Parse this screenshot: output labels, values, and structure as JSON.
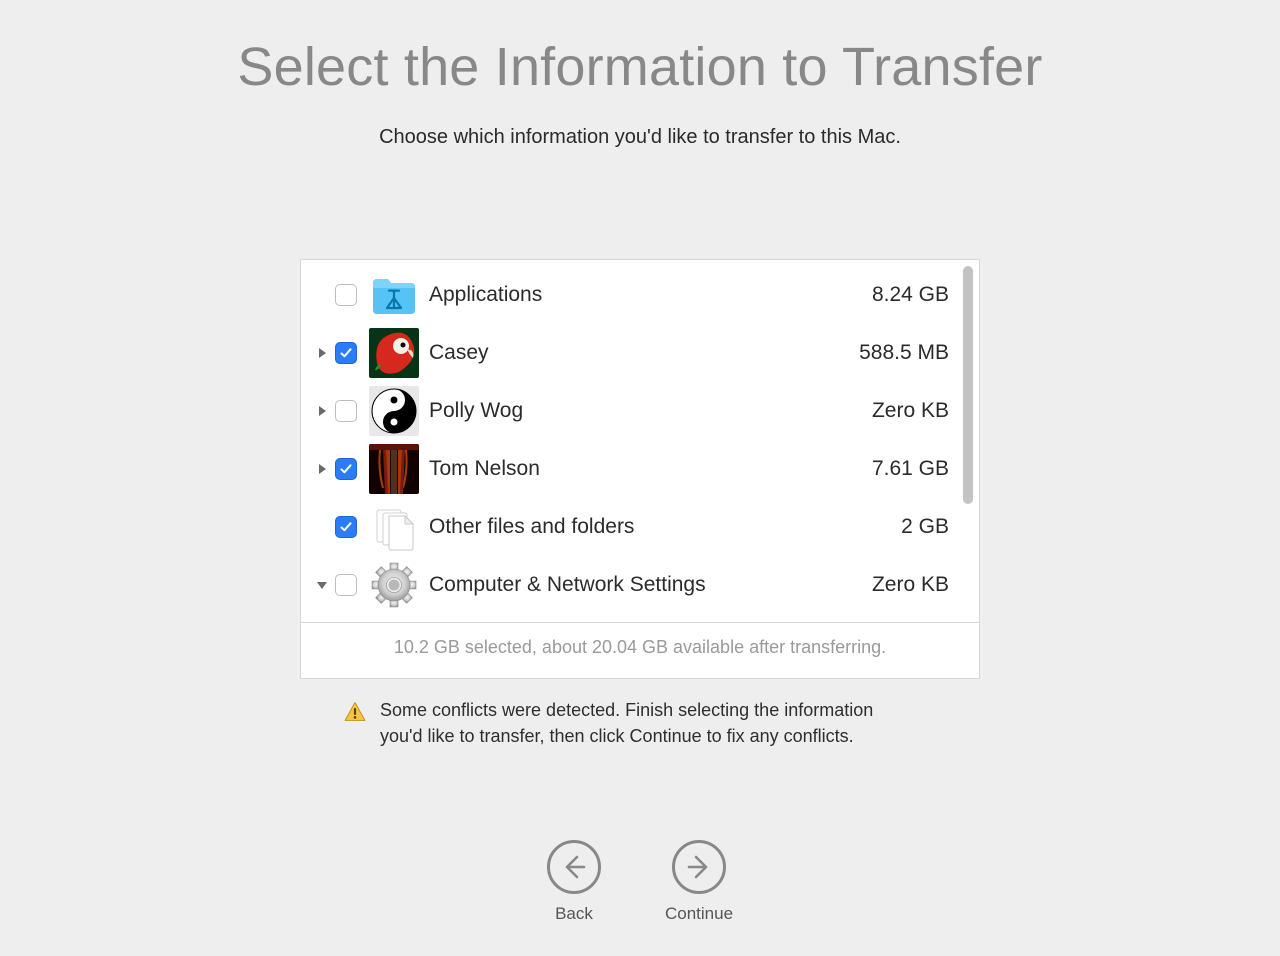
{
  "title": "Select the Information to Transfer",
  "subtitle": "Choose which information you'd like to transfer to this Mac.",
  "items": [
    {
      "name": "Applications",
      "size": "8.24 GB",
      "checked": false,
      "expandable": false,
      "expanded": false,
      "icon": "folder-applications"
    },
    {
      "name": "Casey",
      "size": "588.5 MB",
      "checked": true,
      "expandable": true,
      "expanded": false,
      "icon": "avatar-parrot"
    },
    {
      "name": "Polly Wog",
      "size": "Zero KB",
      "checked": false,
      "expandable": true,
      "expanded": false,
      "icon": "avatar-yinyang"
    },
    {
      "name": "Tom Nelson",
      "size": "7.61 GB",
      "checked": true,
      "expandable": true,
      "expanded": false,
      "icon": "avatar-violin"
    },
    {
      "name": "Other files and folders",
      "size": "2 GB",
      "checked": true,
      "expandable": false,
      "expanded": false,
      "icon": "documents"
    },
    {
      "name": "Computer & Network Settings",
      "size": "Zero KB",
      "checked": false,
      "expandable": true,
      "expanded": true,
      "icon": "gear"
    }
  ],
  "summary": "10.2 GB selected, about 20.04 GB available after transferring.",
  "conflict_message": "Some conflicts were detected. Finish selecting the information you'd like to transfer, then click Continue to fix any conflicts.",
  "buttons": {
    "back": "Back",
    "continue": "Continue"
  }
}
